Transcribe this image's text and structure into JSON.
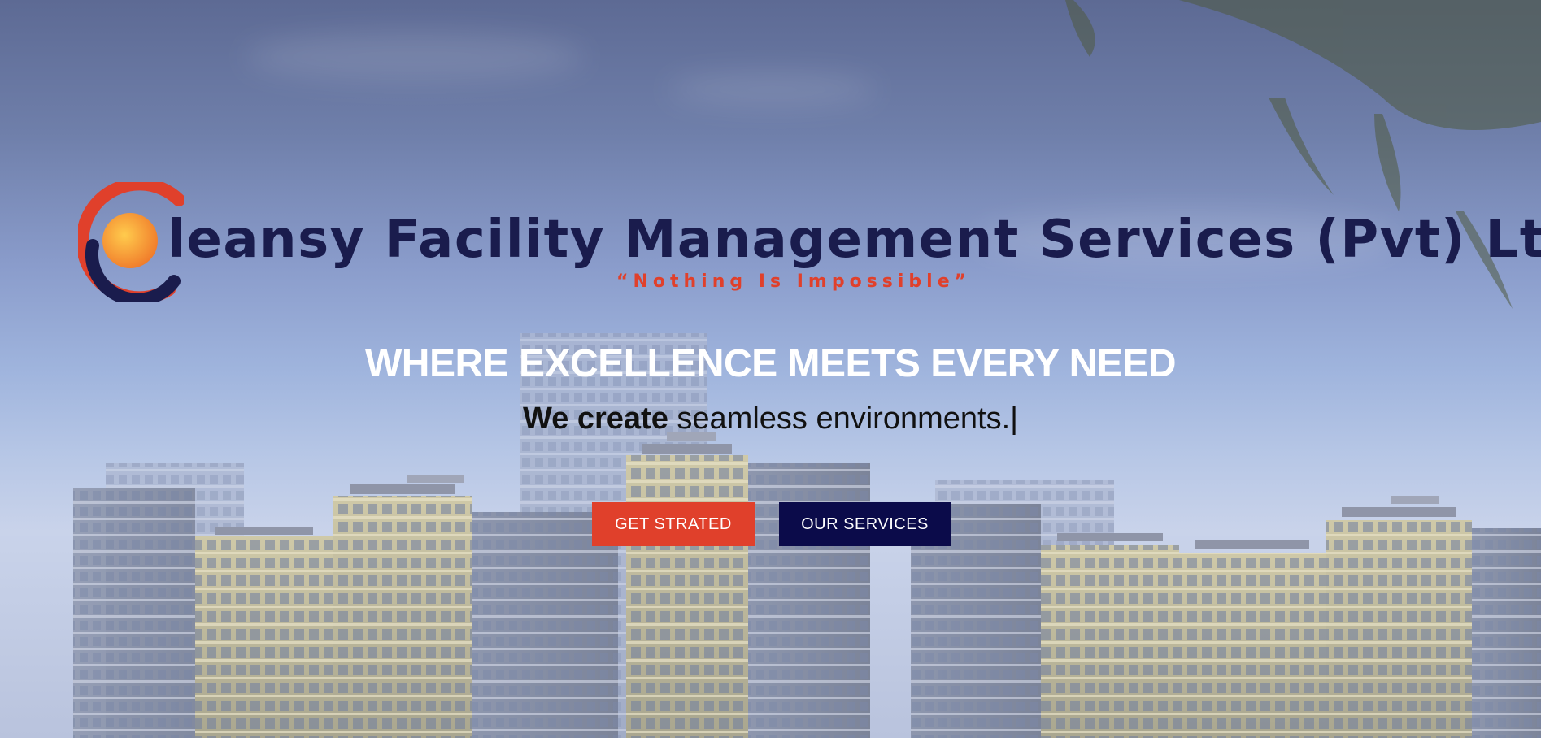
{
  "brand": {
    "name": "leansy Facility Management Services (Pvt) Ltd",
    "tagline": "“Nothing Is Impossible”",
    "colors": {
      "navy": "#1a1c4d",
      "red": "#e0402b",
      "orange": "#f7a43c"
    }
  },
  "hero": {
    "headline": "WHERE EXCELLENCE MEETS EVERY NEED",
    "sub_strong": "We create",
    "sub_text": " seamless environments.",
    "cursor": "|",
    "buttons": {
      "start_label": "GET STRATED",
      "services_label": "OUR SERVICES"
    },
    "button_colors": {
      "start": "#e0402b",
      "services": "#0b0b4a"
    }
  }
}
